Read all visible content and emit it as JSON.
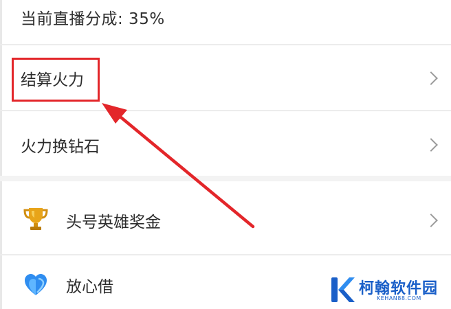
{
  "header": {
    "share_text": "当前直播分成: 35%"
  },
  "menu": {
    "settle_fire": "结算火力",
    "fire_to_diamond": "火力换钻石",
    "hero_bonus": "头号英雄奖金",
    "loan": "放心借"
  },
  "icons": {
    "trophy": "trophy-icon",
    "heart": "heart-icon",
    "chevron": "chevron-right-icon"
  },
  "watermark": {
    "name": "柯翰软件园",
    "site": "KEHAN88.COM"
  },
  "colors": {
    "highlight": "#e3262a",
    "divider": "#ececec",
    "watermark": "#1a5fc8"
  }
}
